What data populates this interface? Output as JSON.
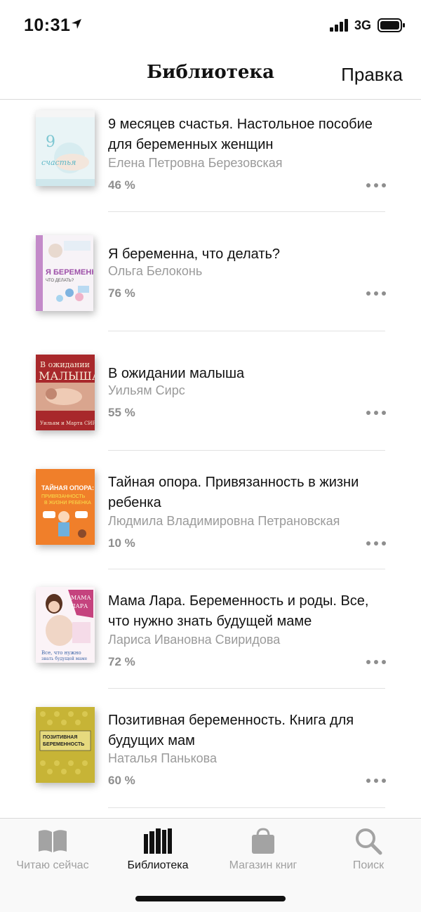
{
  "status": {
    "time": "10:31",
    "network": "3G"
  },
  "nav": {
    "title": "Библиотека",
    "edit": "Правка"
  },
  "books": [
    {
      "title": "9 месяцев счастья. Настольное пособие для беременных женщин",
      "author": "Елена Петровна Березовская",
      "progress": "46 %"
    },
    {
      "title": "Я беременна, что делать?",
      "author": "Ольга  Белоконь",
      "progress": "76 %"
    },
    {
      "title": "В ожидании малыша",
      "author": "Уильям  Сирс",
      "progress": "55 %"
    },
    {
      "title": "Тайная опора. Привязанность в жизни ребенка",
      "author": "Людмила Владимировна Петрановская",
      "progress": "10 %"
    },
    {
      "title": "Мама Лара. Беременность и роды. Все, что нужно знать будущей маме",
      "author": "Лариса Ивановна Свиридова",
      "progress": "72 %"
    },
    {
      "title": "Позитивная беременность. Книга для будущих мам",
      "author": "Наталья  Панькова",
      "progress": "60 %"
    }
  ],
  "tabs": [
    {
      "label": "Читаю сейчас",
      "icon": "open-book-icon"
    },
    {
      "label": "Библиотека",
      "icon": "library-icon"
    },
    {
      "label": "Магазин книг",
      "icon": "shopping-bag-icon"
    },
    {
      "label": "Поиск",
      "icon": "search-icon"
    }
  ],
  "colors": {
    "accent": "#111111",
    "inactive": "#a0a0a0",
    "secondary_text": "#9a9a9a"
  }
}
